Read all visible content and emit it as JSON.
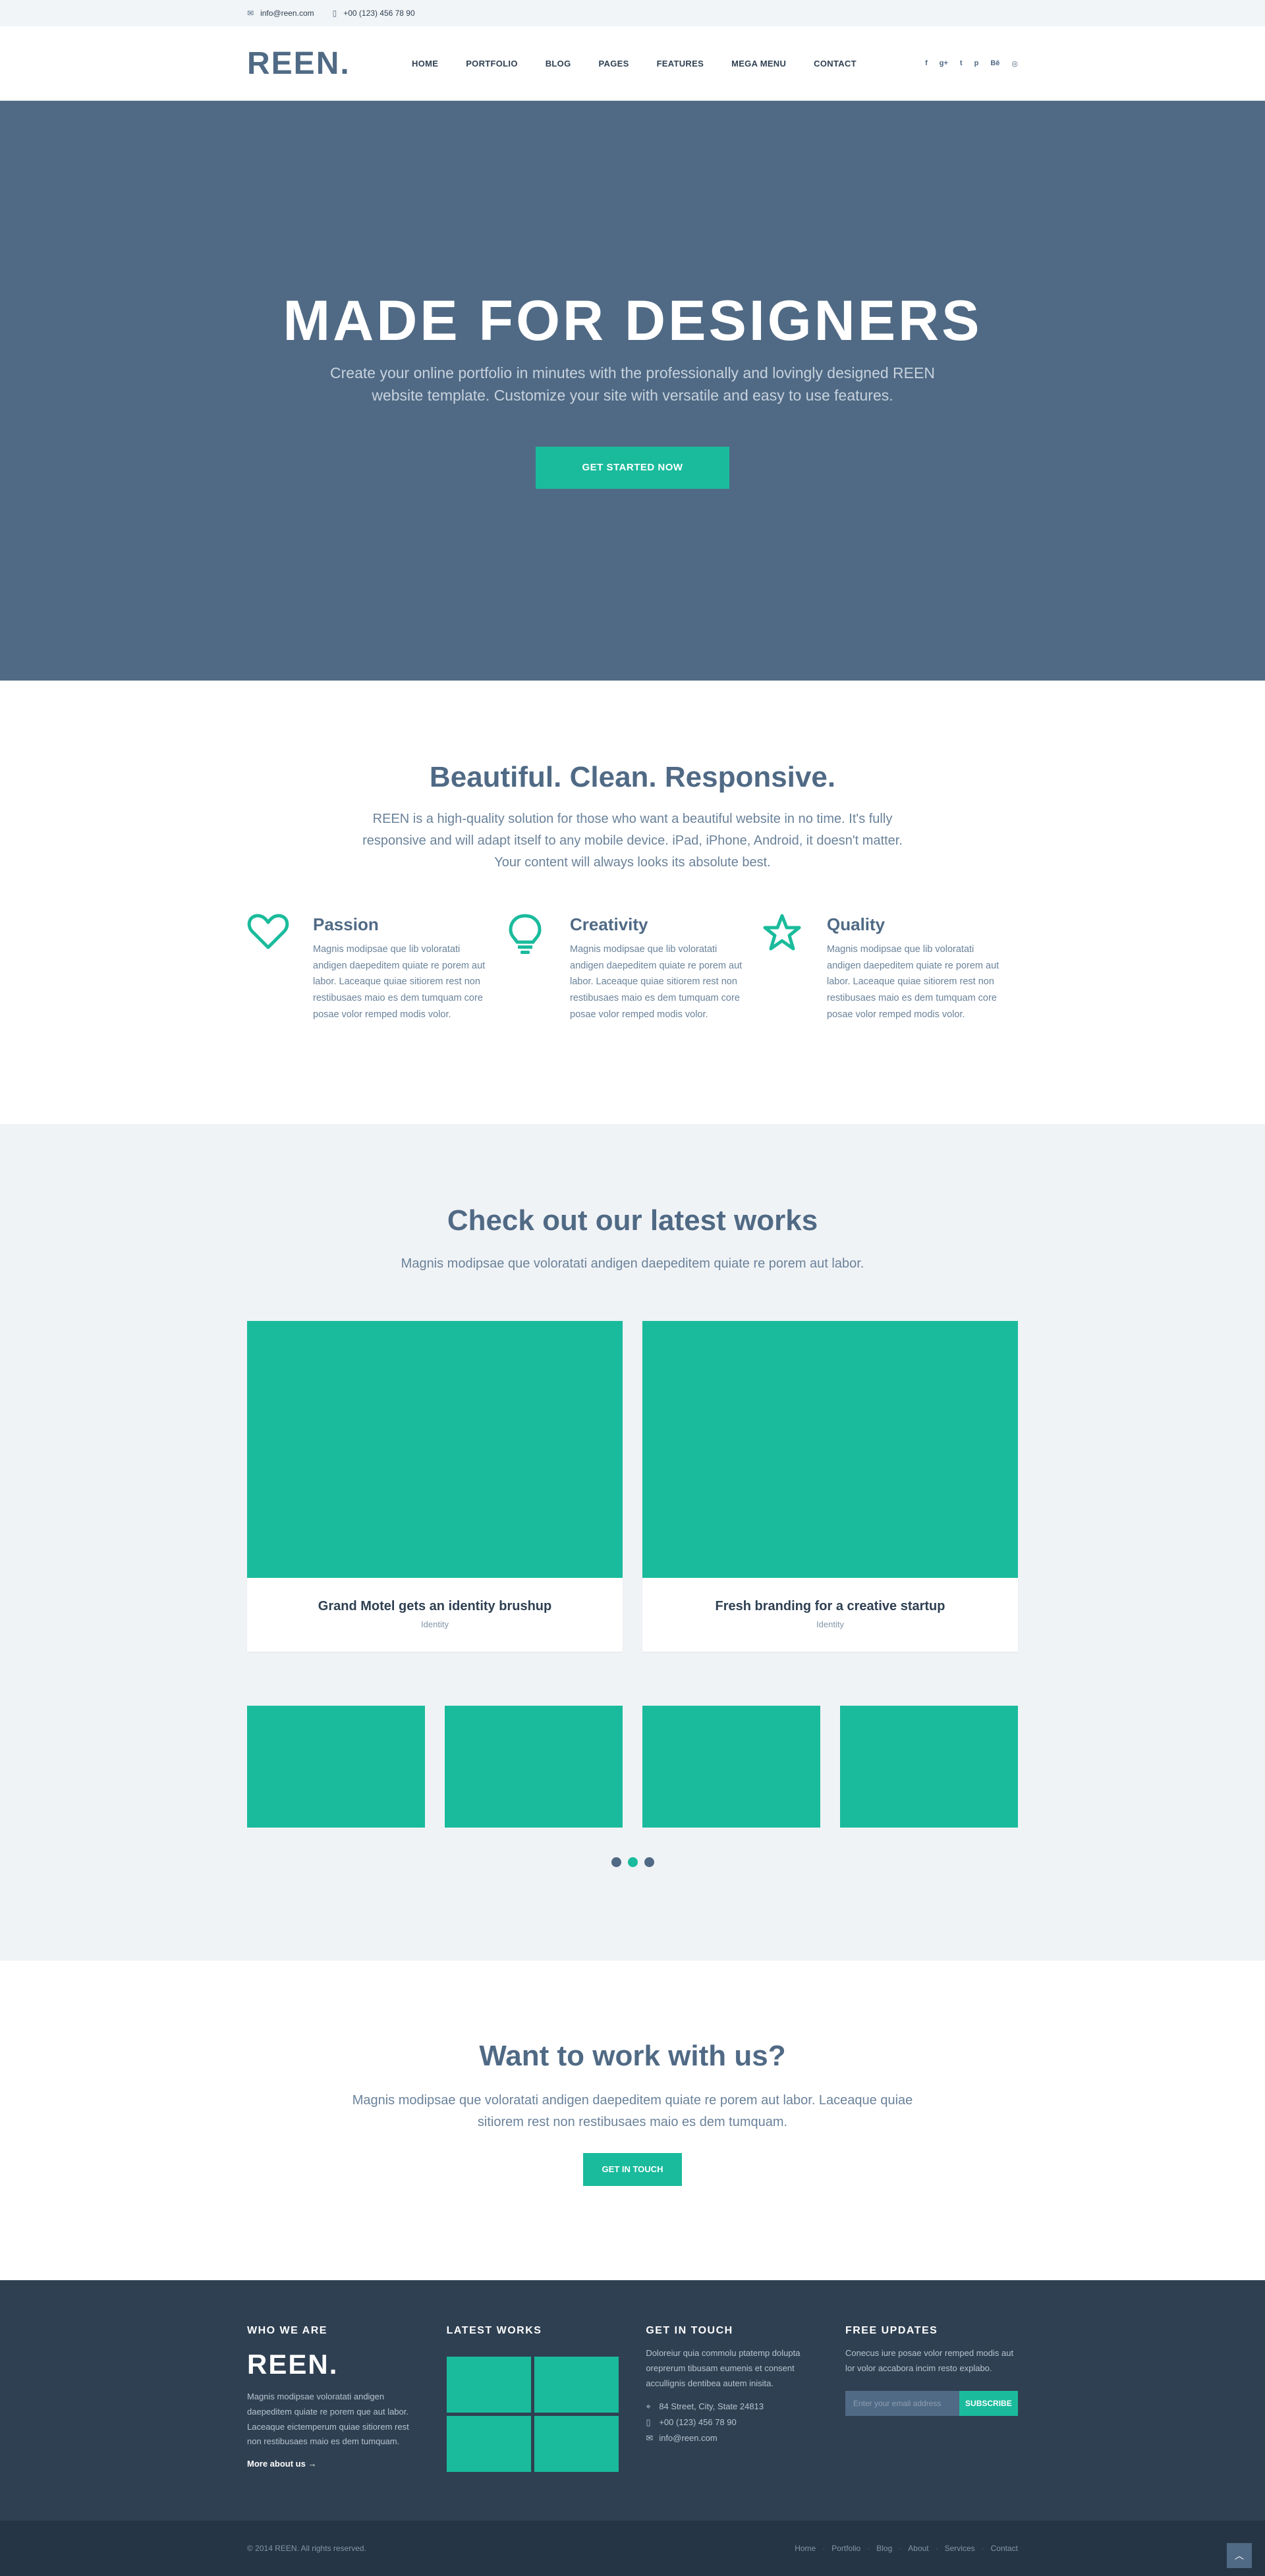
{
  "topbar": {
    "email": "info@reen.com",
    "phone": "+00 (123) 456 78 90"
  },
  "header": {
    "logo": "REEN.",
    "nav": [
      "HOME",
      "PORTFOLIO",
      "BLOG",
      "PAGES",
      "FEATURES",
      "MEGA MENU",
      "CONTACT"
    ],
    "social_icons": [
      "facebook-icon",
      "google-plus-icon",
      "twitter-icon",
      "pinterest-icon",
      "behance-icon",
      "dribbble-icon"
    ]
  },
  "hero": {
    "title": "MADE FOR DESIGNERS",
    "subtitle": "Create your online portfolio in minutes with the professionally and lovingly designed REEN website template. Customize your site with versatile and easy to use features.",
    "button": "GET STARTED NOW"
  },
  "features": {
    "title": "Beautiful. Clean. Responsive.",
    "subtitle": "REEN is a high-quality solution for those who want a beautiful website in no time. It's fully responsive and will adapt itself to any mobile device. iPad, iPhone, Android, it doesn't matter. Your content will always looks its absolute best.",
    "items": [
      {
        "icon": "heart-icon",
        "title": "Passion",
        "text": "Magnis modipsae que lib voloratati andigen daepeditem quiate re porem aut labor. Laceaque quiae sitiorem rest non restibusaes maio es dem tumquam core posae volor remped modis volor."
      },
      {
        "icon": "lightbulb-icon",
        "title": "Creativity",
        "text": "Magnis modipsae que lib voloratati andigen daepeditem quiate re porem aut labor. Laceaque quiae sitiorem rest non restibusaes maio es dem tumquam core posae volor remped modis volor."
      },
      {
        "icon": "star-icon",
        "title": "Quality",
        "text": "Magnis modipsae que lib voloratati andigen daepeditem quiate re porem aut labor. Laceaque quiae sitiorem rest non restibusaes maio es dem tumquam core posae volor remped modis volor."
      }
    ]
  },
  "works": {
    "title": "Check out our latest works",
    "subtitle": "Magnis modipsae que voloratati andigen daepeditem quiate re porem aut labor.",
    "cards": [
      {
        "title": "Grand Motel gets an identity brushup",
        "category": "Identity"
      },
      {
        "title": "Fresh branding for a creative startup",
        "category": "Identity"
      }
    ]
  },
  "cta": {
    "title": "Want to work with us?",
    "subtitle": "Magnis modipsae que voloratati andigen daepeditem quiate re porem aut labor. Laceaque quiae sitiorem rest non restibusaes maio es dem tumquam.",
    "button": "GET IN TOUCH"
  },
  "footer": {
    "about": {
      "heading": "WHO WE ARE",
      "logo": "REEN.",
      "text": "Magnis modipsae voloratati andigen daepeditem quiate re porem que aut labor. Laceaque eictemperum quiae sitiorem rest non restibusaes maio es dem tumquam.",
      "more": "More about us →"
    },
    "works_heading": "LATEST WORKS",
    "contact": {
      "heading": "GET IN TOUCH",
      "text": "Doloreiur quia commolu ptatemp dolupta oreprerum tibusam eumenis et consent accullignis dentibea autem inisita.",
      "address": "84 Street, City, State 24813",
      "phone": "+00 (123) 456 78 90",
      "email": "info@reen.com"
    },
    "updates": {
      "heading": "FREE UPDATES",
      "text": "Conecus iure posae volor remped modis aut lor volor accabora incim resto explabo.",
      "placeholder": "Enter your email address",
      "button": "SUBSCRIBE"
    }
  },
  "bottom": {
    "copyright": "© 2014 REEN. All rights reserved.",
    "links": [
      "Home",
      "Portfolio",
      "Blog",
      "About",
      "Services",
      "Contact"
    ],
    "totop_icon": "chevron-up-icon"
  },
  "colors": {
    "primary": "#506a85",
    "accent": "#1abb9c",
    "dark": "#2f4052",
    "light_bg": "#f0f3f6"
  }
}
